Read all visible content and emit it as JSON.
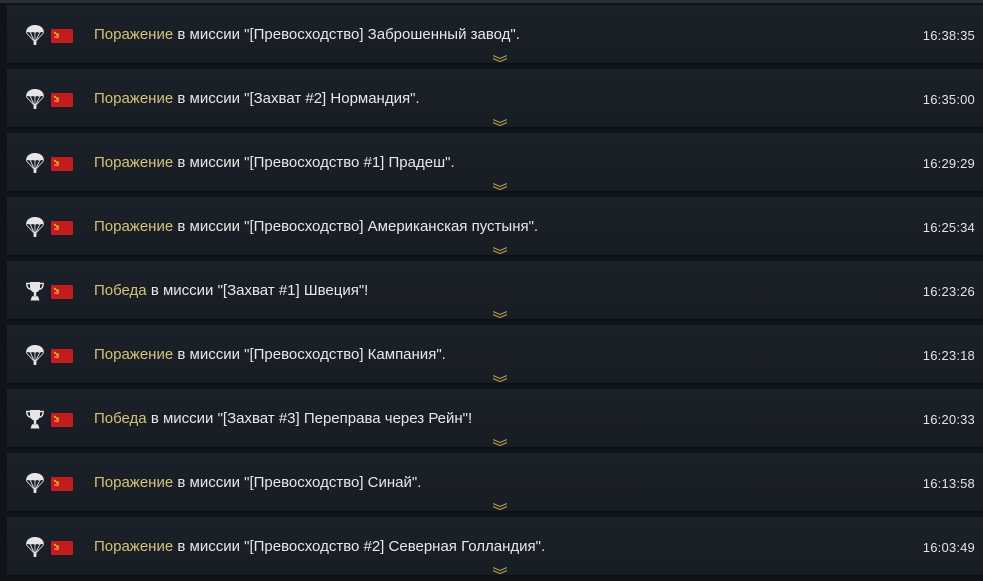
{
  "colors": {
    "result_text": "#d9c07a",
    "message_text": "#e8e8e8",
    "row_background": "#1b2129",
    "flag_red": "#c21c1c",
    "expand_chevron": "#b39a52"
  },
  "battles": [
    {
      "result_icon": "parachute-icon",
      "result": "Поражение",
      "middle": " в миссии ",
      "mission": "\"[Превосходство] Заброшенный завод\".",
      "time": "16:38:35"
    },
    {
      "result_icon": "parachute-icon",
      "result": "Поражение",
      "middle": " в миссии ",
      "mission": "\"[Захват #2] Нормандия\".",
      "time": "16:35:00"
    },
    {
      "result_icon": "parachute-icon",
      "result": "Поражение",
      "middle": " в миссии ",
      "mission": "\"[Превосходство #1] Прадеш\".",
      "time": "16:29:29"
    },
    {
      "result_icon": "parachute-icon",
      "result": "Поражение",
      "middle": " в миссии ",
      "mission": "\"[Превосходство] Американская пустыня\".",
      "time": "16:25:34"
    },
    {
      "result_icon": "trophy-icon",
      "result": "Победа",
      "middle": " в миссии ",
      "mission": "\"[Захват #1] Швеция\"!",
      "time": "16:23:26"
    },
    {
      "result_icon": "parachute-icon",
      "result": "Поражение",
      "middle": " в миссии ",
      "mission": "\"[Превосходство] Кампания\".",
      "time": "16:23:18"
    },
    {
      "result_icon": "trophy-icon",
      "result": "Победа",
      "middle": " в миссии ",
      "mission": "\"[Захват #3] Переправа через Рейн\"!",
      "time": "16:20:33"
    },
    {
      "result_icon": "parachute-icon",
      "result": "Поражение",
      "middle": " в миссии ",
      "mission": "\"[Превосходство] Синай\".",
      "time": "16:13:58"
    },
    {
      "result_icon": "parachute-icon",
      "result": "Поражение",
      "middle": " в миссии ",
      "mission": "\"[Превосходство #2] Северная Голландия\".",
      "time": "16:03:49"
    }
  ],
  "flag_icon": "ussr-flag-icon",
  "expand_icon": "chevron-down-double-icon"
}
